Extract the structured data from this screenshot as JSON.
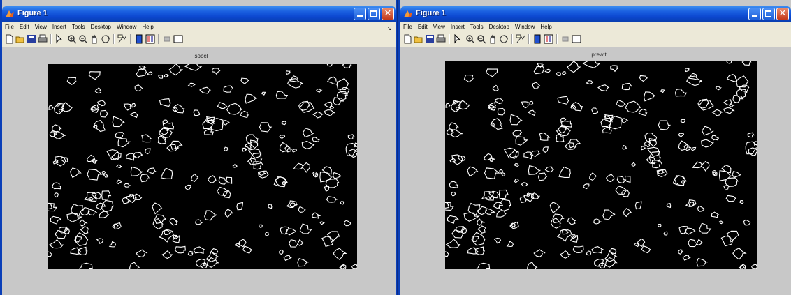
{
  "windows": [
    {
      "title": "Figure 1",
      "menu": [
        "File",
        "Edit",
        "View",
        "Insert",
        "Tools",
        "Desktop",
        "Window",
        "Help"
      ],
      "axes_title": "sobel"
    },
    {
      "title": "Figure 1",
      "menu": [
        "File",
        "Edit",
        "View",
        "Insert",
        "Tools",
        "Desktop",
        "Window",
        "Help"
      ],
      "axes_title": "prewit"
    }
  ],
  "toolbar_icons": [
    "new-figure-icon",
    "open-file-icon",
    "save-icon",
    "print-icon",
    "edit-plot-icon",
    "zoom-in-icon",
    "zoom-out-icon",
    "pan-icon",
    "rotate-3d-icon",
    "data-cursor-icon",
    "colorbar-icon",
    "legend-icon",
    "hide-plot-tools-icon",
    "show-plot-tools-icon"
  ],
  "colors": {
    "titlebar": "#0b46cf",
    "figure_bg": "#c8c8c8",
    "image_bg": "#000000",
    "edges": "#ffffff"
  }
}
